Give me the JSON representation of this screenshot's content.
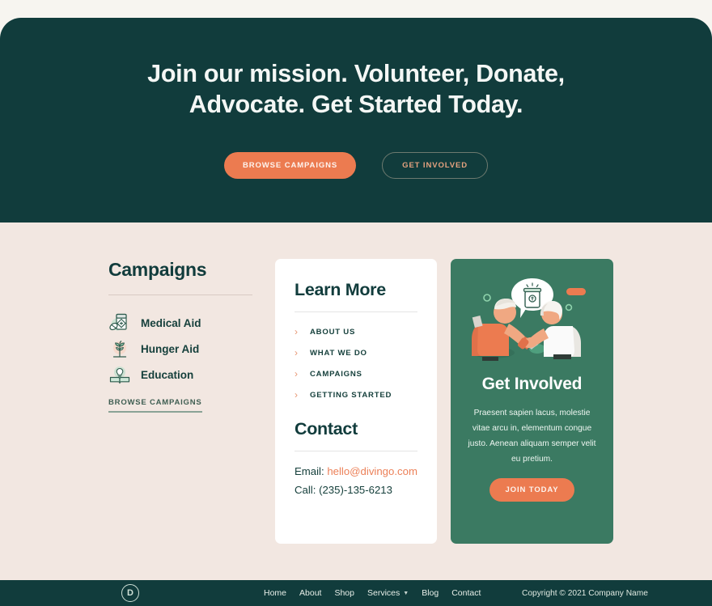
{
  "hero": {
    "title": "Join our mission. Volunteer, Donate, Advocate. Get Started Today.",
    "primary_button": "BROWSE CAMPAIGNS",
    "secondary_button": "GET INVOLVED",
    "background_color": "#113c3c",
    "accent_color": "#ec7b50"
  },
  "campaigns": {
    "title": "Campaigns",
    "items": [
      {
        "label": "Medical Aid",
        "icon": "medicine-box-icon"
      },
      {
        "label": "Hunger Aid",
        "icon": "sprout-plant-icon"
      },
      {
        "label": "Education",
        "icon": "open-book-lightbulb-icon"
      }
    ],
    "browse_link": "BROWSE CAMPAIGNS"
  },
  "learn_more": {
    "title": "Learn More",
    "links": [
      {
        "label": "ABOUT US",
        "icon": "chevron-right-icon"
      },
      {
        "label": "WHAT WE DO",
        "icon": "chevron-right-icon"
      },
      {
        "label": "CAMPAIGNS",
        "icon": "chevron-right-icon"
      },
      {
        "label": "GETTING STARTED",
        "icon": "chevron-right-icon"
      }
    ]
  },
  "contact": {
    "title": "Contact",
    "email_label": "Email:",
    "email_value": "hello@divingo.com",
    "phone_label": "Call:",
    "phone_value": "(235)-135-6213",
    "email_color": "#ec8058"
  },
  "get_involved": {
    "title": "Get Involved",
    "body": "Praesent sapien lacus, molestie vitae arcu in, elementum congue justo. Aenean aliquam semper velit eu pretium.",
    "button": "JOIN TODAY",
    "illustration": "two-people-handshake-donation-jar-illustration",
    "background_color": "#3b7a62"
  },
  "footer": {
    "logo": "D",
    "nav": [
      {
        "label": "Home",
        "has_dropdown": false
      },
      {
        "label": "About",
        "has_dropdown": false
      },
      {
        "label": "Shop",
        "has_dropdown": false
      },
      {
        "label": "Services",
        "has_dropdown": true
      },
      {
        "label": "Blog",
        "has_dropdown": false
      },
      {
        "label": "Contact",
        "has_dropdown": false
      }
    ],
    "copyright": "Copyright © 2021 Company Name"
  }
}
